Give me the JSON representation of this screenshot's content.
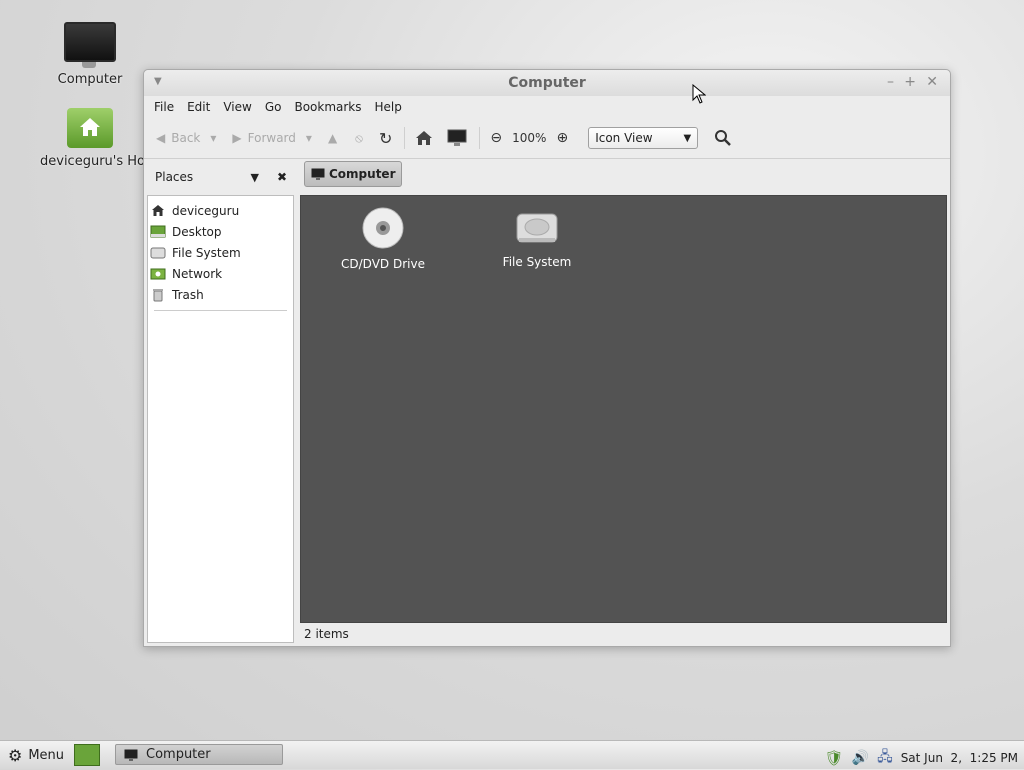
{
  "desktop": {
    "icons": [
      {
        "label": "Computer"
      },
      {
        "label": "deviceguru's Hom"
      }
    ]
  },
  "window": {
    "title": "Computer",
    "menu": [
      "File",
      "Edit",
      "View",
      "Go",
      "Bookmarks",
      "Help"
    ],
    "toolbar": {
      "back": "Back",
      "forward": "Forward",
      "zoom": "100%",
      "view_mode": "Icon View"
    },
    "sidebar": {
      "title": "Places",
      "items": [
        {
          "label": "deviceguru",
          "icon": "home-icon"
        },
        {
          "label": "Desktop",
          "icon": "desktop-icon"
        },
        {
          "label": "File System",
          "icon": "drive-icon"
        },
        {
          "label": "Network",
          "icon": "network-icon"
        },
        {
          "label": "Trash",
          "icon": "trash-icon"
        }
      ]
    },
    "path": [
      "Computer"
    ],
    "items": [
      {
        "label": "CD/DVD Drive",
        "icon": "cd-icon"
      },
      {
        "label": "File System",
        "icon": "harddisk-icon"
      }
    ],
    "status": "2 items"
  },
  "taskbar": {
    "menu_label": "Menu",
    "task": "Computer",
    "clock": "Sat Jun  2,  1:25 PM"
  }
}
